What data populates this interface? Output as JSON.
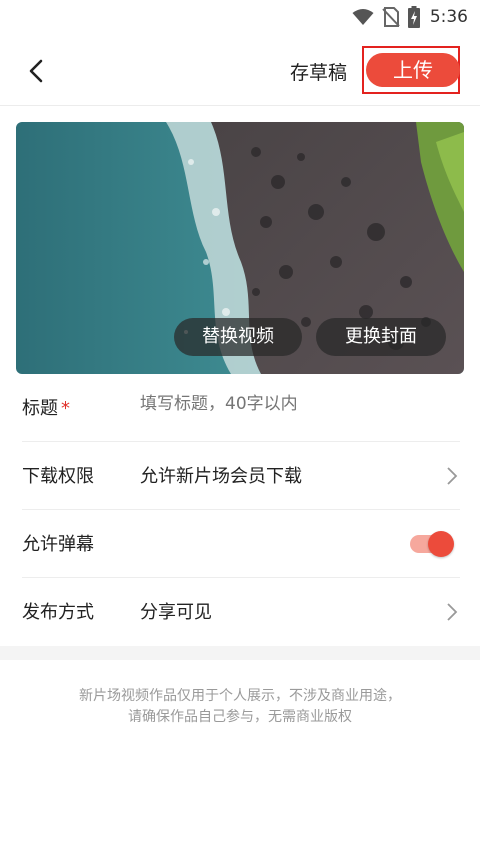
{
  "status_bar": {
    "time": "5:36",
    "icons": [
      "wifi-icon",
      "no-sim-icon",
      "battery-charging-icon"
    ]
  },
  "header": {
    "draft_label": "存草稿",
    "upload_label": "上传",
    "back_icon": "back-arrow-icon"
  },
  "preview": {
    "replace_video_label": "替换视频",
    "change_cover_label": "更换封面"
  },
  "form": {
    "title": {
      "label": "标题",
      "required_mark": "*",
      "placeholder": "填写标题，40字以内",
      "value": ""
    },
    "download": {
      "label": "下载权限",
      "value": "允许新片场会员下载"
    },
    "danmaku": {
      "label": "允许弹幕",
      "enabled": true
    },
    "publish": {
      "label": "发布方式",
      "value": "分享可见"
    }
  },
  "notice": {
    "line1": "新片场视频作品仅用于个人展示，不涉及商业用途，",
    "line2": "请确保作品自己参与，无需商业版权"
  },
  "colors": {
    "accent": "#ec4b3b",
    "highlight_border": "#e3221f"
  }
}
